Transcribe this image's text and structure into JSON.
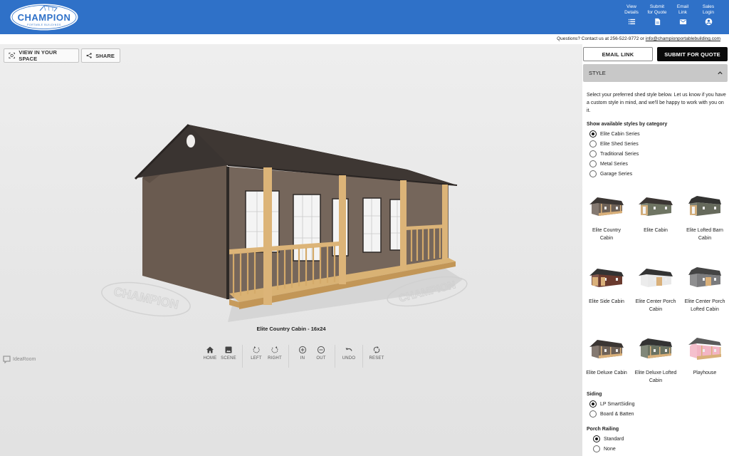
{
  "header": {
    "brand": "CHAMPION",
    "brand_sub": "PORTABLE BUILDINGS",
    "nav": [
      {
        "label_line1": "View",
        "label_line2": "Details",
        "icon": "list-icon"
      },
      {
        "label_line1": "Submit",
        "label_line2": "for Quote",
        "icon": "document-icon"
      },
      {
        "label_line1": "Email",
        "label_line2": "Link",
        "icon": "mail-icon"
      },
      {
        "label_line1": "Sales",
        "label_line2": "Login",
        "icon": "account-icon"
      }
    ],
    "color": "#2f71c8"
  },
  "contact": {
    "prefix": "Questions? Contact us at 256-522-9772 or ",
    "email": "info@championportablebuilding.com"
  },
  "viewer": {
    "view_in_space_label": "VIEW IN YOUR SPACE",
    "share_label": "SHARE",
    "model_caption": "Elite Country Cabin - 16x24",
    "watermark_text": "CHAMPION",
    "controls": [
      {
        "label": "HOME",
        "icon": "home-icon"
      },
      {
        "label": "SCENE",
        "icon": "image-icon"
      },
      {
        "label": "LEFT",
        "icon": "rotate-left-icon"
      },
      {
        "label": "RIGHT",
        "icon": "rotate-right-icon"
      },
      {
        "label": "IN",
        "icon": "zoom-in-icon"
      },
      {
        "label": "OUT",
        "icon": "zoom-out-icon"
      },
      {
        "label": "UNDO",
        "icon": "undo-icon"
      },
      {
        "label": "RESET",
        "icon": "reset-icon"
      }
    ],
    "powered_by": "IdeaRoom"
  },
  "panel": {
    "email_link_label": "EMAIL LINK",
    "submit_quote_label": "SUBMIT FOR QUOTE",
    "section_title": "STYLE",
    "description": "Select your preferred shed style below. Let us know if you have a custom style in mind, and we'll be happy to work with you on it.",
    "category_label": "Show available styles by category",
    "categories": [
      {
        "label": "Elite Cabin Series",
        "selected": true
      },
      {
        "label": "Elite Shed Series",
        "selected": false
      },
      {
        "label": "Traditional Series",
        "selected": false
      },
      {
        "label": "Metal Series",
        "selected": false
      },
      {
        "label": "Garage Series",
        "selected": false
      }
    ],
    "styles": [
      {
        "name": "Elite Country Cabin",
        "siding": "#6e6258",
        "trim": "#d9b07a",
        "roof": "#3b3633",
        "type": "country"
      },
      {
        "name": "Elite Cabin",
        "siding": "#6f7563",
        "trim": "#d9b07a",
        "roof": "#3b3633",
        "type": "cabin"
      },
      {
        "name": "Elite Lofted Barn Cabin",
        "siding": "#666a5c",
        "trim": "#d9b07a",
        "roof": "#333331",
        "type": "barn"
      },
      {
        "name": "Elite Side Cabin",
        "siding": "#6a3a2e",
        "trim": "#d9b07a",
        "roof": "#333",
        "type": "side"
      },
      {
        "name": "Elite Center Porch Cabin",
        "siding": "#e9e9e9",
        "trim": "#d9b07a",
        "roof": "#333",
        "type": "center"
      },
      {
        "name": "Elite Center Porch Lofted Cabin",
        "siding": "#7b7b7d",
        "trim": "#d9b07a",
        "roof": "#444",
        "type": "centerbarn"
      },
      {
        "name": "Elite Deluxe Cabin",
        "siding": "#6e6258",
        "trim": "#d9b07a",
        "roof": "#3b3633",
        "type": "deluxe"
      },
      {
        "name": "Elite Deluxe Lofted Cabin",
        "siding": "#6a7262",
        "trim": "#d9b07a",
        "roof": "#333",
        "type": "deluxebarn"
      },
      {
        "name": "Playhouse",
        "siding": "#f3b5c4",
        "trim": "#d9b07a",
        "roof": "#5a5a5a",
        "type": "play"
      }
    ],
    "siding_label": "Siding",
    "siding_options": [
      {
        "label": "LP SmartSiding",
        "selected": true
      },
      {
        "label": "Board & Batten",
        "selected": false
      }
    ],
    "porch_railing_label": "Porch Railing",
    "porch_railing_options": [
      {
        "label": "Standard",
        "selected": true
      },
      {
        "label": "None",
        "selected": false
      }
    ]
  }
}
